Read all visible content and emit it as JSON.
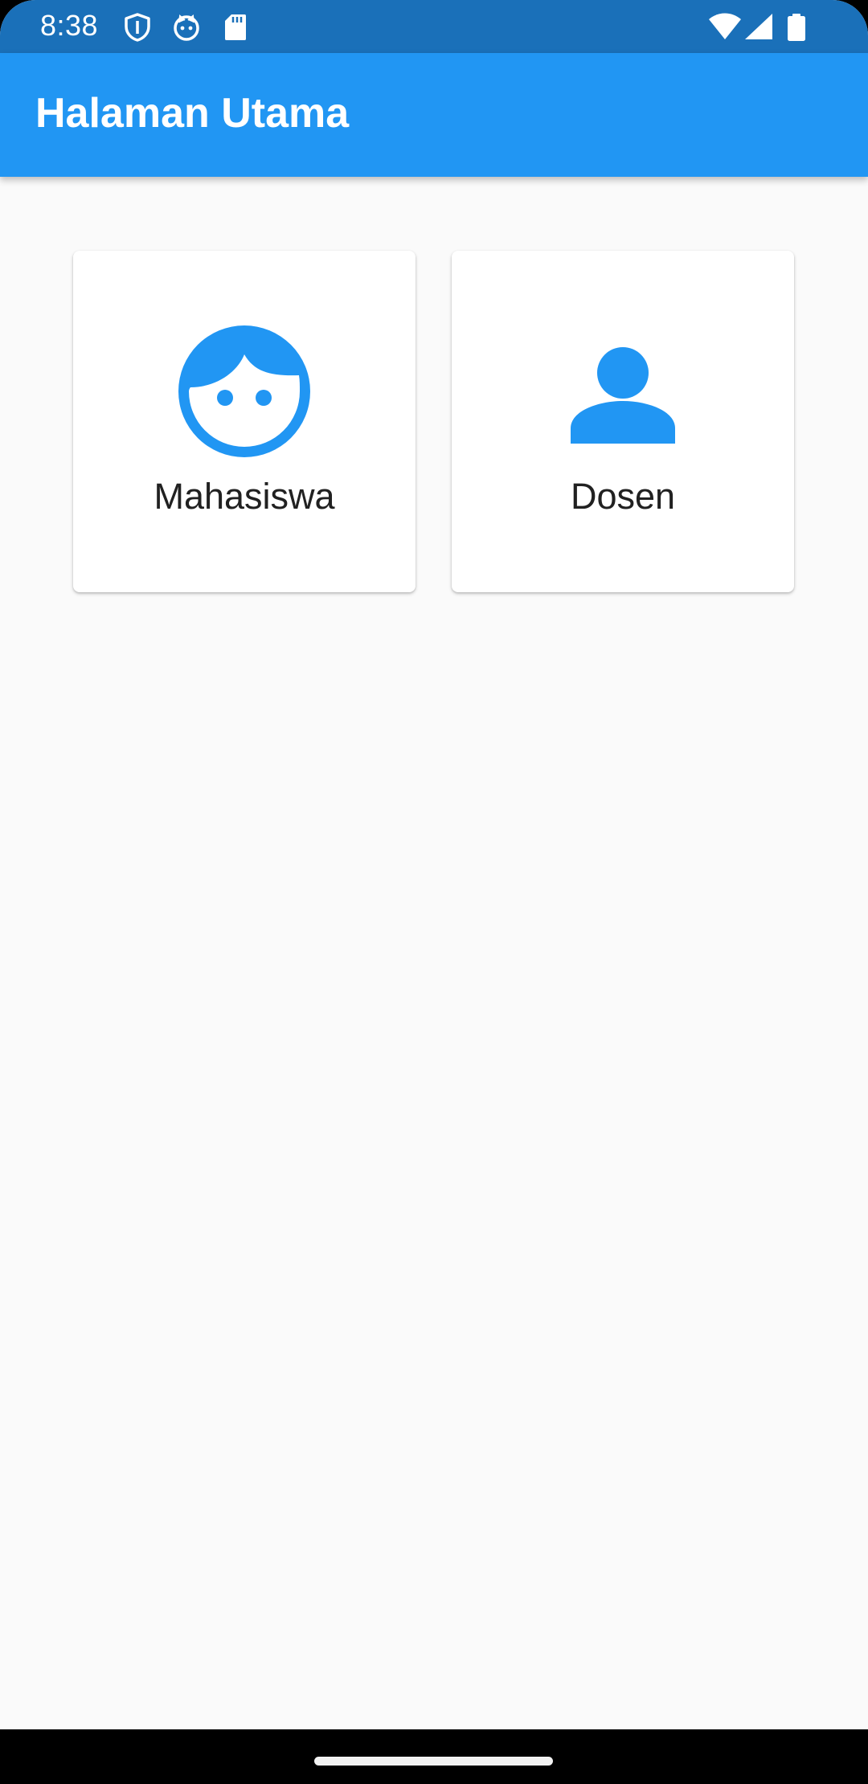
{
  "status_bar": {
    "time": "8:38",
    "left_icons": [
      "shield-icon",
      "cat-face-icon",
      "sd-card-icon"
    ],
    "right_icons": [
      "wifi-icon",
      "cellular-signal-icon",
      "battery-icon"
    ],
    "background_color": "#1a70b9"
  },
  "app_bar": {
    "title": "Halaman Utama",
    "background_color": "#2196f3"
  },
  "menu": {
    "items": [
      {
        "label": "Mahasiswa",
        "icon": "face-icon"
      },
      {
        "label": "Dosen",
        "icon": "person-icon"
      }
    ],
    "icon_color": "#2196f3"
  },
  "colors": {
    "page_background": "#fafafa",
    "card_background": "#ffffff",
    "label_text": "#212121"
  }
}
